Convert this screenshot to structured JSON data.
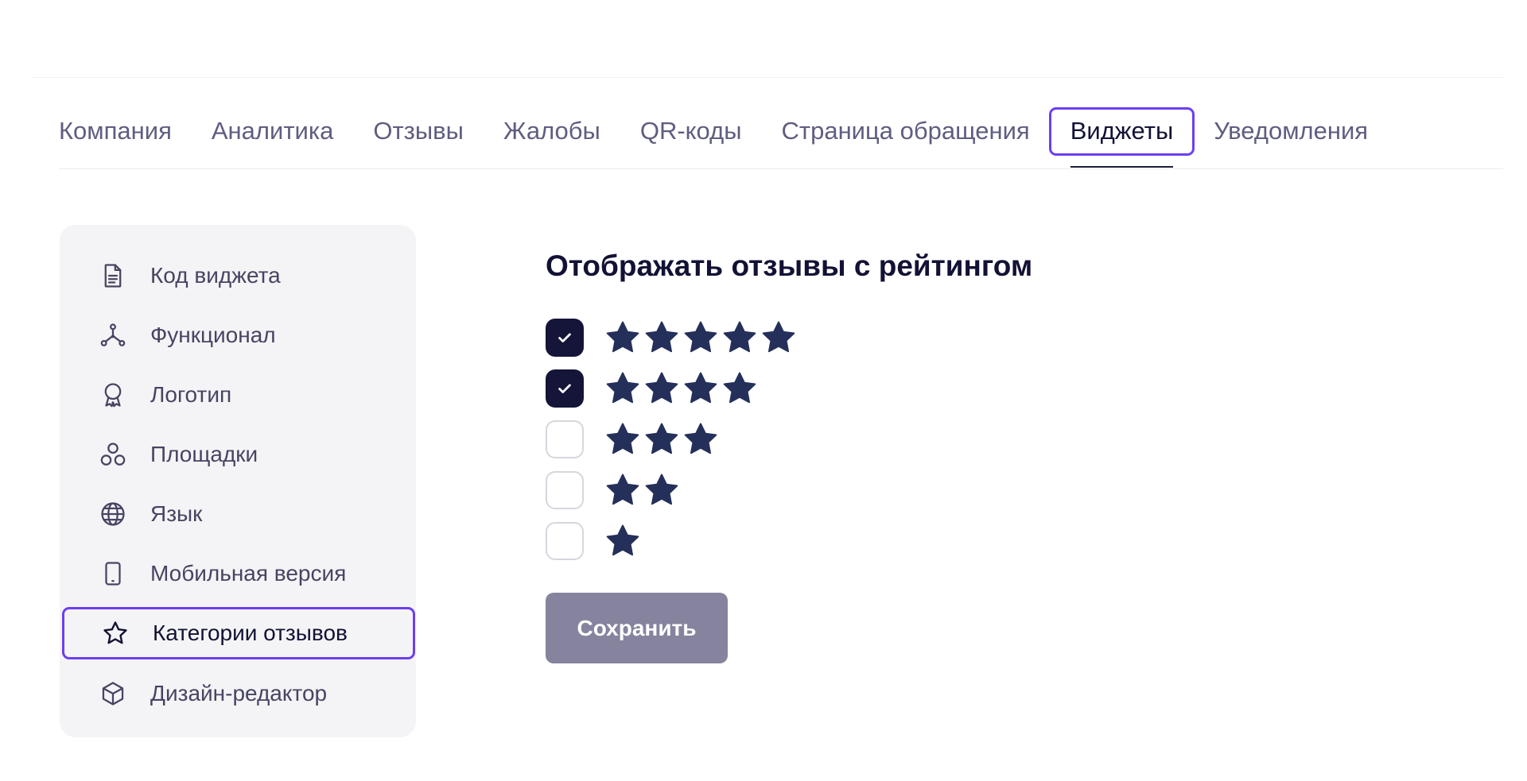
{
  "tabs": [
    {
      "label": "Компания"
    },
    {
      "label": "Аналитика"
    },
    {
      "label": "Отзывы"
    },
    {
      "label": "Жалобы"
    },
    {
      "label": "QR-коды"
    },
    {
      "label": "Страница обращения"
    },
    {
      "label": "Виджеты",
      "active": true
    },
    {
      "label": "Уведомления"
    }
  ],
  "sidebar": {
    "items": [
      {
        "label": "Код виджета",
        "icon": "document-icon"
      },
      {
        "label": "Функционал",
        "icon": "nodes-icon"
      },
      {
        "label": "Логотип",
        "icon": "award-icon"
      },
      {
        "label": "Площадки",
        "icon": "circles-icon"
      },
      {
        "label": "Язык",
        "icon": "globe-icon"
      },
      {
        "label": "Мобильная версия",
        "icon": "smartphone-icon"
      },
      {
        "label": "Категории отзывов",
        "icon": "star-icon",
        "active": true
      },
      {
        "label": "Дизайн-редактор",
        "icon": "cube-icon"
      }
    ]
  },
  "main": {
    "title": "Отображать отзывы с рейтингом",
    "ratings": [
      {
        "stars": 5,
        "checked": true
      },
      {
        "stars": 4,
        "checked": true
      },
      {
        "stars": 3,
        "checked": false
      },
      {
        "stars": 2,
        "checked": false
      },
      {
        "stars": 1,
        "checked": false
      }
    ],
    "save_label": "Сохранить"
  },
  "colors": {
    "accent": "#6b3ff0",
    "dark": "#121235",
    "star": "#25305a",
    "button": "#85839e",
    "sidebar_bg": "#f4f4f6"
  }
}
